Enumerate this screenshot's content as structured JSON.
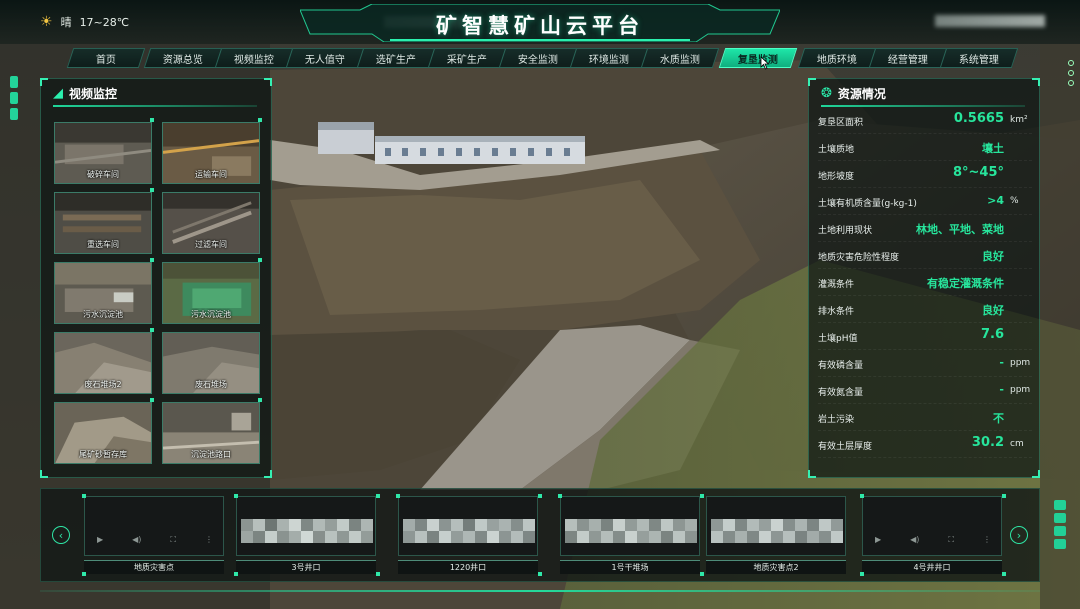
{
  "header": {
    "weather_icon": "sun-icon",
    "weather": "晴",
    "temperature": "17~28℃",
    "title": "矿智慧矿山云平台"
  },
  "nav": {
    "tabs": [
      {
        "label": "首页"
      },
      {
        "label": "资源总览"
      },
      {
        "label": "视频监控"
      },
      {
        "label": "无人值守"
      },
      {
        "label": "选矿生产"
      },
      {
        "label": "采矿生产"
      },
      {
        "label": "安全监测"
      },
      {
        "label": "环境监测"
      },
      {
        "label": "水质监测"
      },
      {
        "label": "复垦监测",
        "active": true
      },
      {
        "label": "地质环境"
      },
      {
        "label": "经营管理"
      },
      {
        "label": "系统管理"
      }
    ],
    "accent": "#1ee6a8"
  },
  "video_panel": {
    "title": "视频监控",
    "cameras": [
      {
        "label": "破碎车间"
      },
      {
        "label": "运输车间"
      },
      {
        "label": "重选车间"
      },
      {
        "label": "过滤车间"
      },
      {
        "label": "污水沉淀池"
      },
      {
        "label": "污水沉淀池"
      },
      {
        "label": "废石堆场2"
      },
      {
        "label": "废石堆场"
      },
      {
        "label": "尾矿砂暂存库"
      },
      {
        "label": "沉淀池路口"
      }
    ]
  },
  "resource_panel": {
    "title": "资源情况",
    "rows": [
      {
        "key": "复垦区面积",
        "value": "0.5665",
        "unit": "km²"
      },
      {
        "key": "土壤质地",
        "value": "壤土",
        "unit": ""
      },
      {
        "key": "地形坡度",
        "value": "8°~45°",
        "unit": ""
      },
      {
        "key": "土壤有机质含量(g-kg-1)",
        "value": ">4",
        "unit": "%"
      },
      {
        "key": "土地利用现状",
        "value": "林地、平地、菜地",
        "unit": ""
      },
      {
        "key": "地质灾害危险性程度",
        "value": "良好",
        "unit": ""
      },
      {
        "key": "灌溉条件",
        "value": "有稳定灌溉条件",
        "unit": ""
      },
      {
        "key": "排水条件",
        "value": "良好",
        "unit": ""
      },
      {
        "key": "土壤pH值",
        "value": "7.6",
        "unit": ""
      },
      {
        "key": "有效磷含量",
        "value": "-",
        "unit": "ppm"
      },
      {
        "key": "有效氮含量",
        "value": "-",
        "unit": "ppm"
      },
      {
        "key": "岩土污染",
        "value": "不",
        "unit": ""
      },
      {
        "key": "有效土层厚度",
        "value": "30.2",
        "unit": "cm"
      }
    ],
    "value_color": "#27e59c"
  },
  "camera_strip": {
    "cameras": [
      {
        "label": "地质灾害点"
      },
      {
        "label": "3号井口"
      },
      {
        "label": "1220井口"
      },
      {
        "label": "1号干堆场"
      },
      {
        "label": "地质灾害点2"
      },
      {
        "label": "4号井井口"
      }
    ],
    "prev_icon": "chevron-left-icon",
    "next_icon": "chevron-right-icon"
  }
}
